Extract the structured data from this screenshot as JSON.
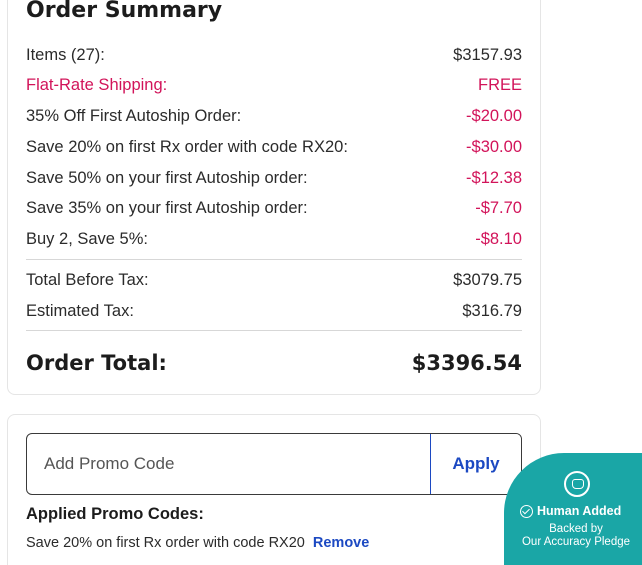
{
  "summary": {
    "title": "Order Summary",
    "lines": [
      {
        "label": "Items (27):",
        "value": "$3157.93"
      },
      {
        "label": "Flat-Rate Shipping:",
        "value": "FREE"
      },
      {
        "label": "35% Off First Autoship Order:",
        "value": "-$20.00"
      },
      {
        "label": "Save 20% on first Rx order with code RX20:",
        "value": "-$30.00"
      },
      {
        "label": "Save 50% on your first Autoship order:",
        "value": "-$12.38"
      },
      {
        "label": "Save 35% on your first Autoship order:",
        "value": "-$7.70"
      },
      {
        "label": "Buy 2, Save 5%:",
        "value": "-$8.10"
      }
    ],
    "before_tax": {
      "label": "Total Before Tax:",
      "value": "$3079.75"
    },
    "tax": {
      "label": "Estimated Tax:",
      "value": "$316.79"
    },
    "order_total": {
      "label": "Order Total:",
      "value": "$3396.54"
    }
  },
  "promo": {
    "placeholder": "Add Promo Code",
    "apply_label": "Apply",
    "applied_title": "Applied Promo Codes:",
    "applied_code": "Save 20% on first Rx order with code RX20",
    "remove_label": "Remove"
  },
  "badge": {
    "title": "Human Added",
    "line1": "Backed by",
    "line2": "Our Accuracy Pledge"
  },
  "colors": {
    "discount_red": "#d2145a",
    "link_blue": "#1c49c2",
    "badge_teal": "#1aa6a6"
  }
}
